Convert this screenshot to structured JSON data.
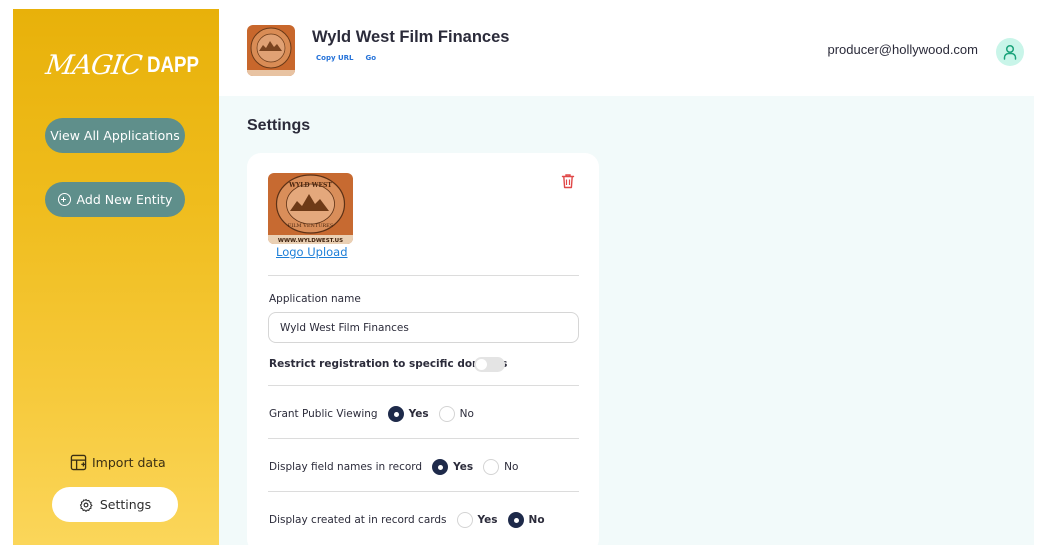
{
  "sidebar": {
    "logo_script": "MAGIC",
    "logo_block": "DAPP",
    "view_all_label": "View All Applications",
    "add_entity_label": "Add New Entity",
    "import_label": "Import data",
    "settings_label": "Settings"
  },
  "header": {
    "app_title": "Wyld West Film Finances",
    "copy_url_label": "Copy URL",
    "go_label": "Go",
    "user_email": "producer@hollywood.com"
  },
  "settings": {
    "page_title": "Settings",
    "logo_text_top": "WYLD WEST",
    "logo_text_bottom": "FILM VENTURES",
    "logo_text_url": "WWW.WYLDWEST.US",
    "logo_upload_label": "Logo Upload",
    "app_name_label": "Application name",
    "app_name_value": "Wyld West Film Finances",
    "restrict_label": "Restrict registration to specific domains",
    "restrict_enabled": false,
    "public_viewing": {
      "label": "Grant Public Viewing",
      "yes": "Yes",
      "no": "No",
      "selected": "Yes"
    },
    "field_names": {
      "label": "Display field names in record",
      "yes": "Yes",
      "no": "No",
      "selected": "Yes"
    },
    "created_at": {
      "label": "Display created at in record cards",
      "yes": "Yes",
      "no": "No",
      "selected": "No"
    }
  },
  "colors": {
    "sidebar_gradient_top": "#e8b10a",
    "sidebar_gradient_bottom": "#fbd65a",
    "sidebar_button": "#5f8f8b",
    "link_blue": "#1d7fd8",
    "radio_checked": "#1e2a4a",
    "avatar_bg": "#c9f5e9"
  }
}
